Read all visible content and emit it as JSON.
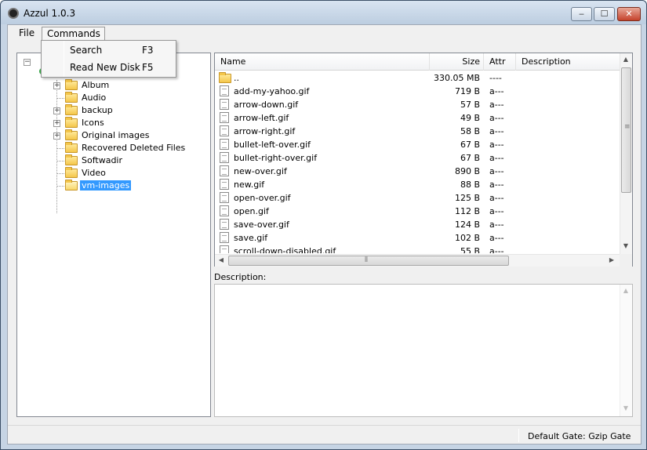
{
  "window": {
    "title": "Azzul 1.0.3",
    "min_glyph": "‒",
    "max_glyph": "☐",
    "close_glyph": "✕"
  },
  "menu": {
    "file": "File",
    "commands": "Commands",
    "dropdown": [
      {
        "label": "Search",
        "shortcut": "F3"
      },
      {
        "label": "Read New Disk",
        "shortcut": "F5"
      }
    ]
  },
  "tree": {
    "items": [
      {
        "label": "Album",
        "expandable": true
      },
      {
        "label": "Audio",
        "expandable": false
      },
      {
        "label": "backup",
        "expandable": true
      },
      {
        "label": "Icons",
        "expandable": true
      },
      {
        "label": "Original images",
        "expandable": true
      },
      {
        "label": "Recovered Deleted Files",
        "expandable": false
      },
      {
        "label": "Softwadir",
        "expandable": false
      },
      {
        "label": "Video",
        "expandable": false
      },
      {
        "label": "vm-images",
        "expandable": false,
        "selected": true
      }
    ]
  },
  "list": {
    "columns": {
      "name": "Name",
      "size": "Size",
      "attr": "Attr",
      "description": "Description"
    },
    "rows": [
      {
        "name": "..",
        "size": "330.05 MB",
        "attr": "----",
        "type": "folder"
      },
      {
        "name": "add-my-yahoo.gif",
        "size": "719 B",
        "attr": "a---",
        "type": "file"
      },
      {
        "name": "arrow-down.gif",
        "size": "57 B",
        "attr": "a---",
        "type": "file"
      },
      {
        "name": "arrow-left.gif",
        "size": "49 B",
        "attr": "a---",
        "type": "file"
      },
      {
        "name": "arrow-right.gif",
        "size": "58 B",
        "attr": "a---",
        "type": "file"
      },
      {
        "name": "bullet-left-over.gif",
        "size": "67 B",
        "attr": "a---",
        "type": "file"
      },
      {
        "name": "bullet-right-over.gif",
        "size": "67 B",
        "attr": "a---",
        "type": "file"
      },
      {
        "name": "new-over.gif",
        "size": "890 B",
        "attr": "a---",
        "type": "file"
      },
      {
        "name": "new.gif",
        "size": "88 B",
        "attr": "a---",
        "type": "file"
      },
      {
        "name": "open-over.gif",
        "size": "125 B",
        "attr": "a---",
        "type": "file"
      },
      {
        "name": "open.gif",
        "size": "112 B",
        "attr": "a---",
        "type": "file"
      },
      {
        "name": "save-over.gif",
        "size": "124 B",
        "attr": "a---",
        "type": "file"
      },
      {
        "name": "save.gif",
        "size": "102 B",
        "attr": "a---",
        "type": "file"
      },
      {
        "name": "scroll-down-disabled.gif",
        "size": "55 B",
        "attr": "a---",
        "type": "file"
      }
    ]
  },
  "description": {
    "label": "Description:"
  },
  "status": {
    "text": "Default Gate: Gzip Gate"
  }
}
